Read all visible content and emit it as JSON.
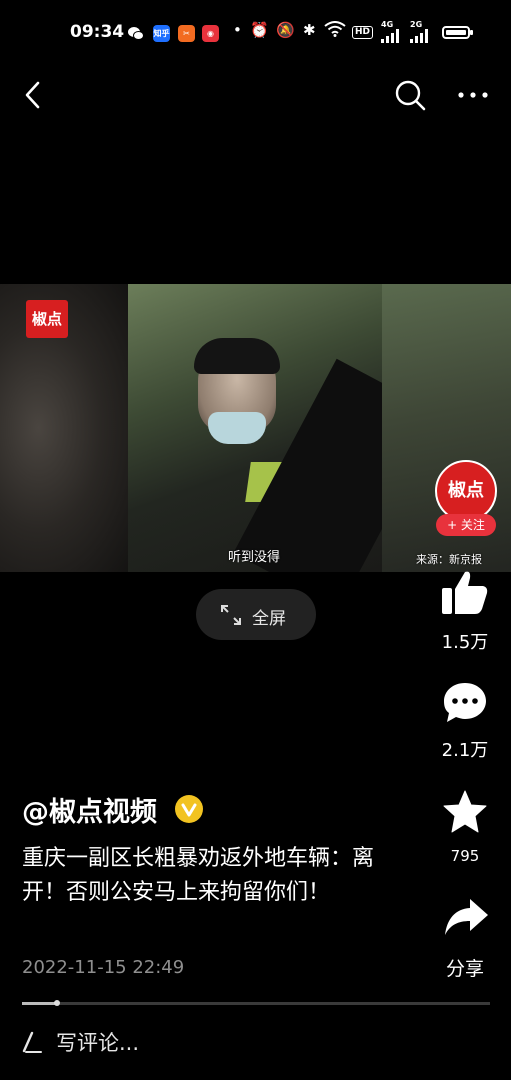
{
  "status_bar": {
    "time": "09:34",
    "apps": [
      {
        "name": "wechat-icon",
        "label": "",
        "color": "#000000"
      },
      {
        "name": "zhihu-icon",
        "label": "知乎",
        "color": "#1e6fff"
      },
      {
        "name": "app-orange-icon",
        "label": "",
        "color": "#f26b21"
      },
      {
        "name": "app-red-icon",
        "label": "",
        "color": "#e8323c"
      }
    ],
    "network_labels": [
      "4G",
      "2G"
    ],
    "hd_label": "HD"
  },
  "video": {
    "watermark_logo": "椒点",
    "subtitle": "听到没得",
    "source": "来源：新京报"
  },
  "author_avatar": {
    "logo_text": "椒点",
    "follow_label": "+ 关注"
  },
  "fullscreen": {
    "label": "全屏"
  },
  "actions": {
    "like": {
      "count": "1.5万"
    },
    "comment": {
      "count": "2.1万"
    },
    "favorite": {
      "count": "795"
    },
    "share": {
      "label": "分享"
    }
  },
  "post": {
    "author": "@椒点视频",
    "title": "重庆一副区长粗暴劝返外地车辆：离开！否则公安马上来拘留你们！",
    "date": "2022-11-15 22:49"
  },
  "progress": {
    "played_fraction": 0.075
  },
  "comment_box": {
    "placeholder": "写评论..."
  },
  "colors": {
    "accent_red": "#d71f20",
    "verified_yellow": "#f2c321",
    "muted_text": "#8f8f8f"
  }
}
